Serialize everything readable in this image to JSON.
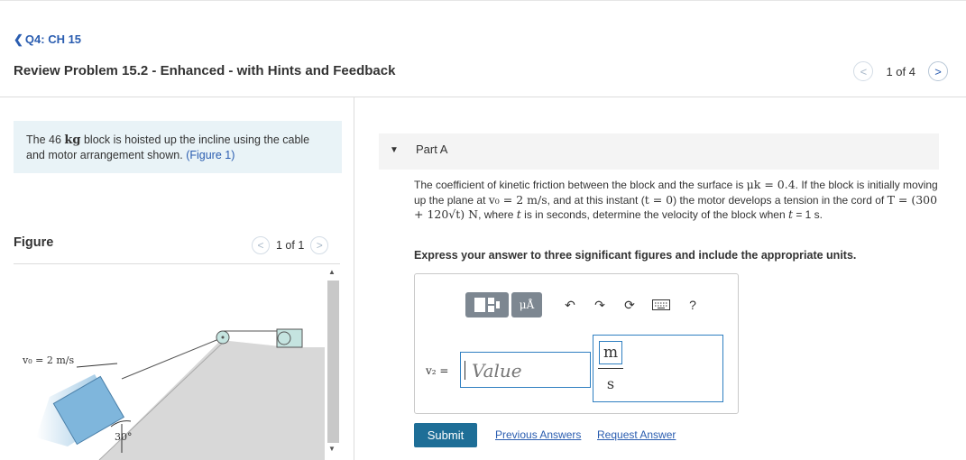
{
  "header": {
    "back_label": "Q4: CH 15",
    "title": "Review Problem 15.2 - Enhanced - with Hints and Feedback",
    "pager_text": "1 of 4"
  },
  "intro": {
    "text_before": "The 46 ",
    "mass_unit": "kg",
    "text_after": " block is hoisted up the incline using the cable and motor arrangement shown. ",
    "figure_link": "(Figure 1)"
  },
  "figure": {
    "label": "Figure",
    "pager_text": "1 of 1",
    "v0_label": "v₀ = 2 m/s",
    "angle_label": "30°"
  },
  "part": {
    "label": "Part A",
    "problem_lines": {
      "l1a": "The coefficient of kinetic friction between the block and the surface is ",
      "mu": "μk = 0.4",
      "l1b": ". If the block is initially moving up the plane at ",
      "v0": "v₀ = 2 m/s",
      "l1c": ", and at this instant (",
      "t0": "t = 0",
      "l1d": ") the motor develops a tension in the cord of ",
      "T": "T = (300 + 120√t) N",
      "l1e": ", where ",
      "tvar": "t",
      "l1f": " is in seconds, determine the velocity of the block when ",
      "t1": "t",
      "l1g": " = 1 s."
    },
    "instruction": "Express your answer to three significant figures and include the appropriate units."
  },
  "answer": {
    "var_label": "v₂ =",
    "value_placeholder": "Value",
    "unit_numerator": "m",
    "unit_denominator": "s",
    "toolbar": {
      "units_label": "μÅ",
      "help_label": "?"
    }
  },
  "actions": {
    "submit": "Submit",
    "previous_answers": "Previous Answers",
    "request_answer": "Request Answer"
  },
  "colors": {
    "link": "#2a5db0",
    "submit_bg": "#1e6e97",
    "intro_bg": "#e9f3f7",
    "block": "#7fb6dc",
    "incline": "#d8d8d8"
  }
}
